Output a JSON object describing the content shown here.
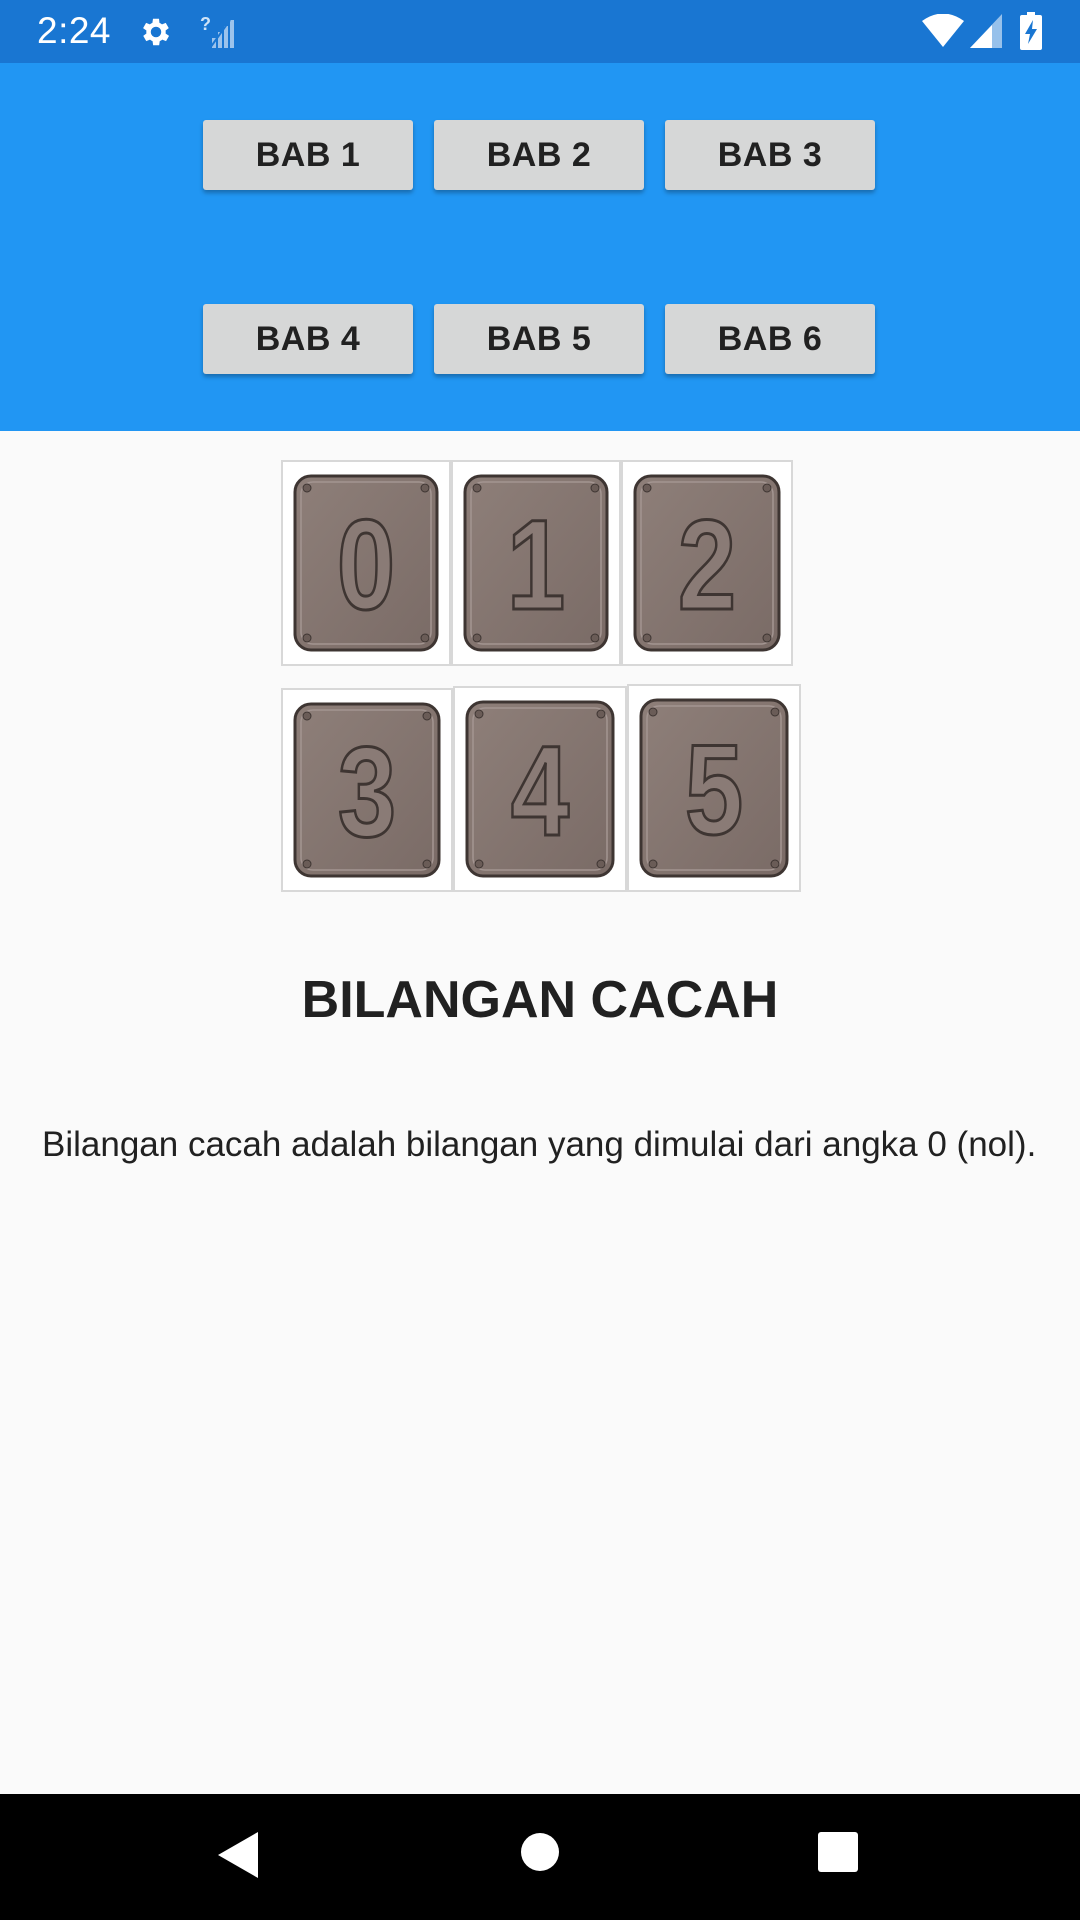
{
  "status_bar": {
    "time": "2:24",
    "icons": [
      "gear-icon",
      "no-signal-icon",
      "wifi-icon",
      "cell-signal-icon",
      "battery-charging-icon"
    ]
  },
  "chapters": [
    {
      "label": "BAB 1"
    },
    {
      "label": "BAB 2"
    },
    {
      "label": "BAB 3"
    },
    {
      "label": "BAB 4"
    },
    {
      "label": "BAB 5"
    },
    {
      "label": "BAB 6"
    }
  ],
  "image": {
    "digits": [
      "0",
      "1",
      "2",
      "3",
      "4",
      "5"
    ]
  },
  "content": {
    "title": "BILANGAN CACAH",
    "description": "Bilangan cacah adalah bilangan yang dimulai dari angka 0 (nol)."
  },
  "nav_bar": {
    "icons": [
      "back-icon",
      "home-icon",
      "recents-icon"
    ]
  },
  "colors": {
    "status_bar": "#1976d2",
    "header": "#2196f3",
    "button": "#d6d7d7",
    "tile_metal": "#7a6b66"
  }
}
